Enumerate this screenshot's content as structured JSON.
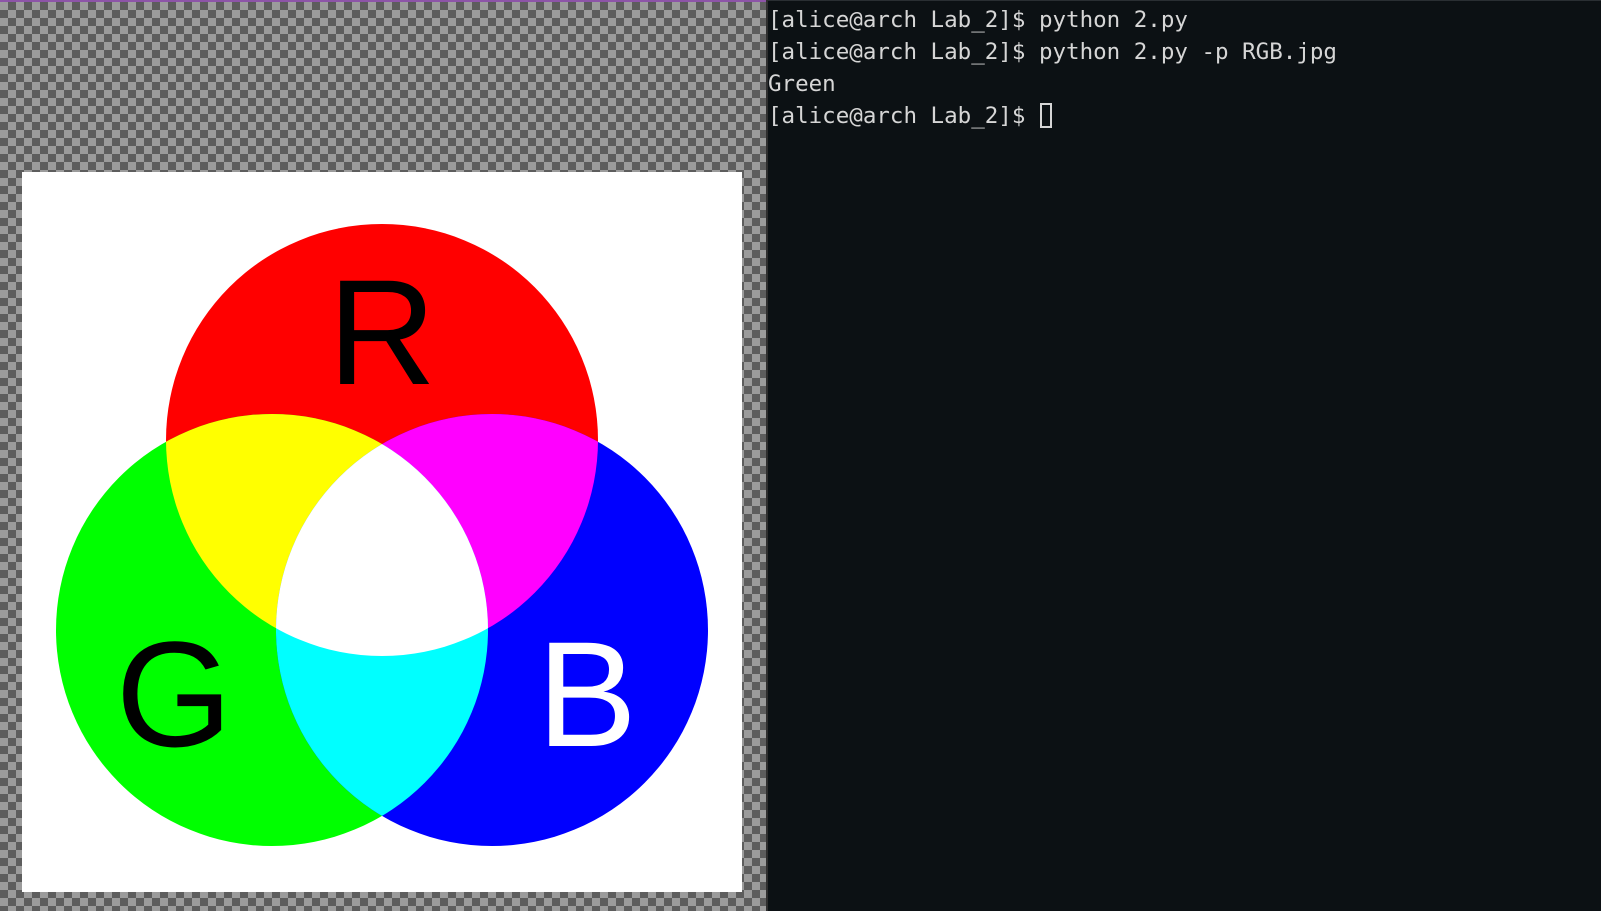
{
  "image_viewer": {
    "image_letters": {
      "red": "R",
      "green": "G",
      "blue": "B"
    },
    "colors": {
      "red": "#ff0000",
      "green": "#00ff00",
      "blue": "#0000ff",
      "yellow": "#ffff00",
      "magenta": "#ff00ff",
      "cyan": "#00ffff",
      "white": "#ffffff"
    }
  },
  "terminal": {
    "lines": [
      {
        "prompt": "[alice@arch Lab_2]$ ",
        "text": "python 2.py"
      },
      {
        "prompt": "[alice@arch Lab_2]$ ",
        "text": "python 2.py -p RGB.jpg"
      },
      {
        "prompt": "",
        "text": "Green"
      },
      {
        "prompt": "[alice@arch Lab_2]$ ",
        "text": ""
      }
    ],
    "colors": {
      "background": "#0c1114",
      "foreground": "#d6d6d6"
    }
  }
}
